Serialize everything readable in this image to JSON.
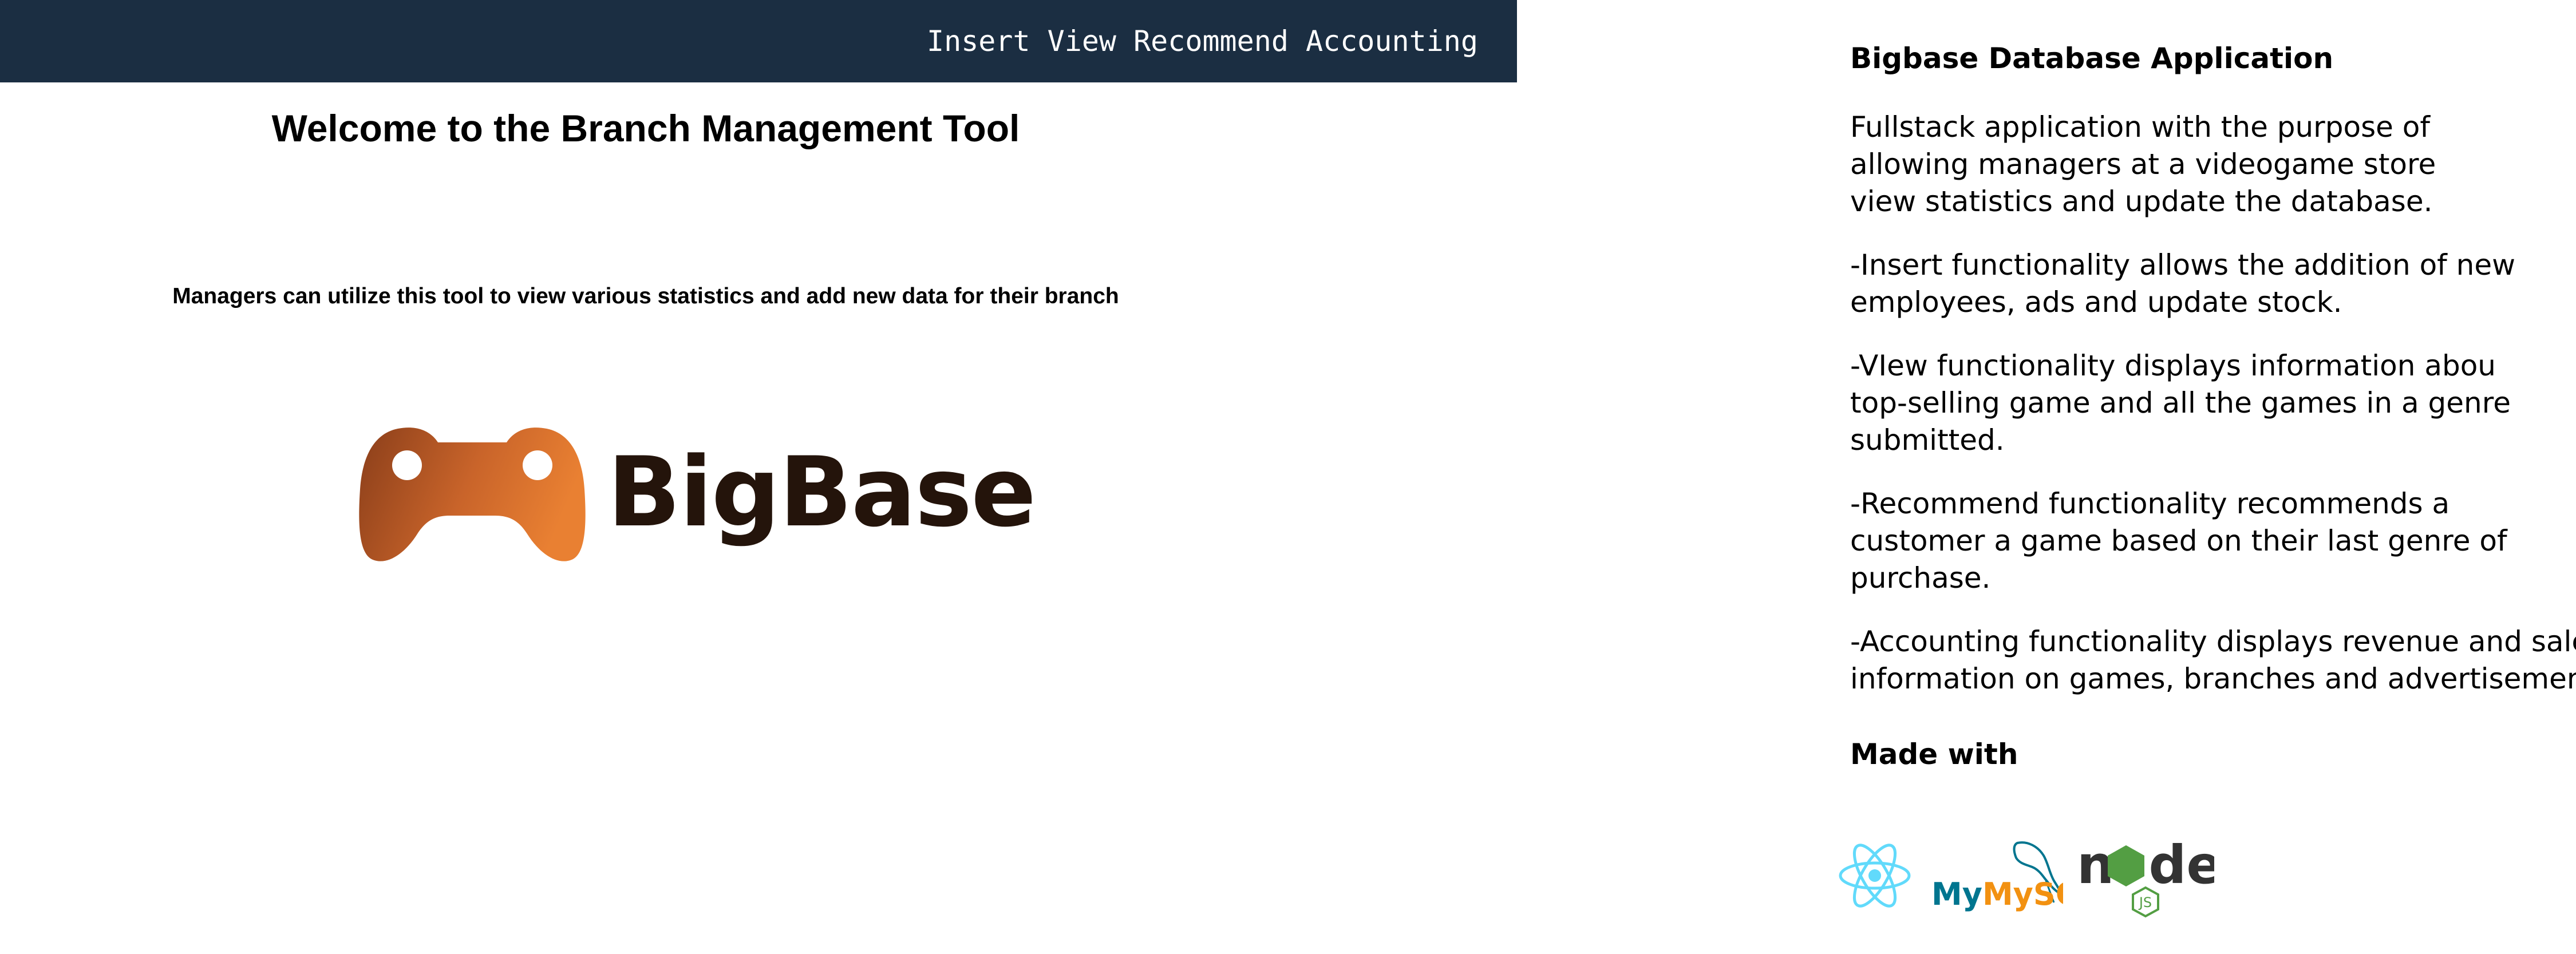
{
  "navbar": {
    "links": [
      "Insert",
      "View",
      "Recommend",
      "Accounting"
    ],
    "background": "#1b2e42"
  },
  "home": {
    "title": "Welcome to the Branch Management Tool",
    "subtitle": "Managers can utilize this tool to view various statistics and add new data for their branch",
    "brand": "BigBase",
    "brand_logo_icon": "gamepad-icon",
    "brand_gradient": [
      "#8a3e1a",
      "#e98032"
    ]
  },
  "description": {
    "title": "Bigbase Database Application",
    "paragraphs": [
      "Fullstack application with the purpose of\nallowing managers at a videogame store\nview statistics and update the database.",
      "-Insert functionality allows the addition of new\nemployees, ads and update stock.",
      "-VIew functionality displays information abou\ntop-selling game and all the games in a genre\nsubmitted.",
      "-Recommend functionality recommends a\ncustomer a game based on their last genre of\npurchase.",
      "-Accounting functionality displays revenue and sales\ninformation on games, branches and advertisement."
    ],
    "made_with_title": "Made with",
    "tech": [
      {
        "icon": "react-icon",
        "label": ""
      },
      {
        "icon": "mysql-logo",
        "label": "MySQL"
      },
      {
        "icon": "nodejs-logo",
        "label": "node"
      }
    ]
  },
  "colors": {
    "react": "#61dafb",
    "mysql_blue": "#00758f",
    "mysql_orange": "#f29111",
    "node_dark": "#333333",
    "node_green": "#539e43"
  }
}
